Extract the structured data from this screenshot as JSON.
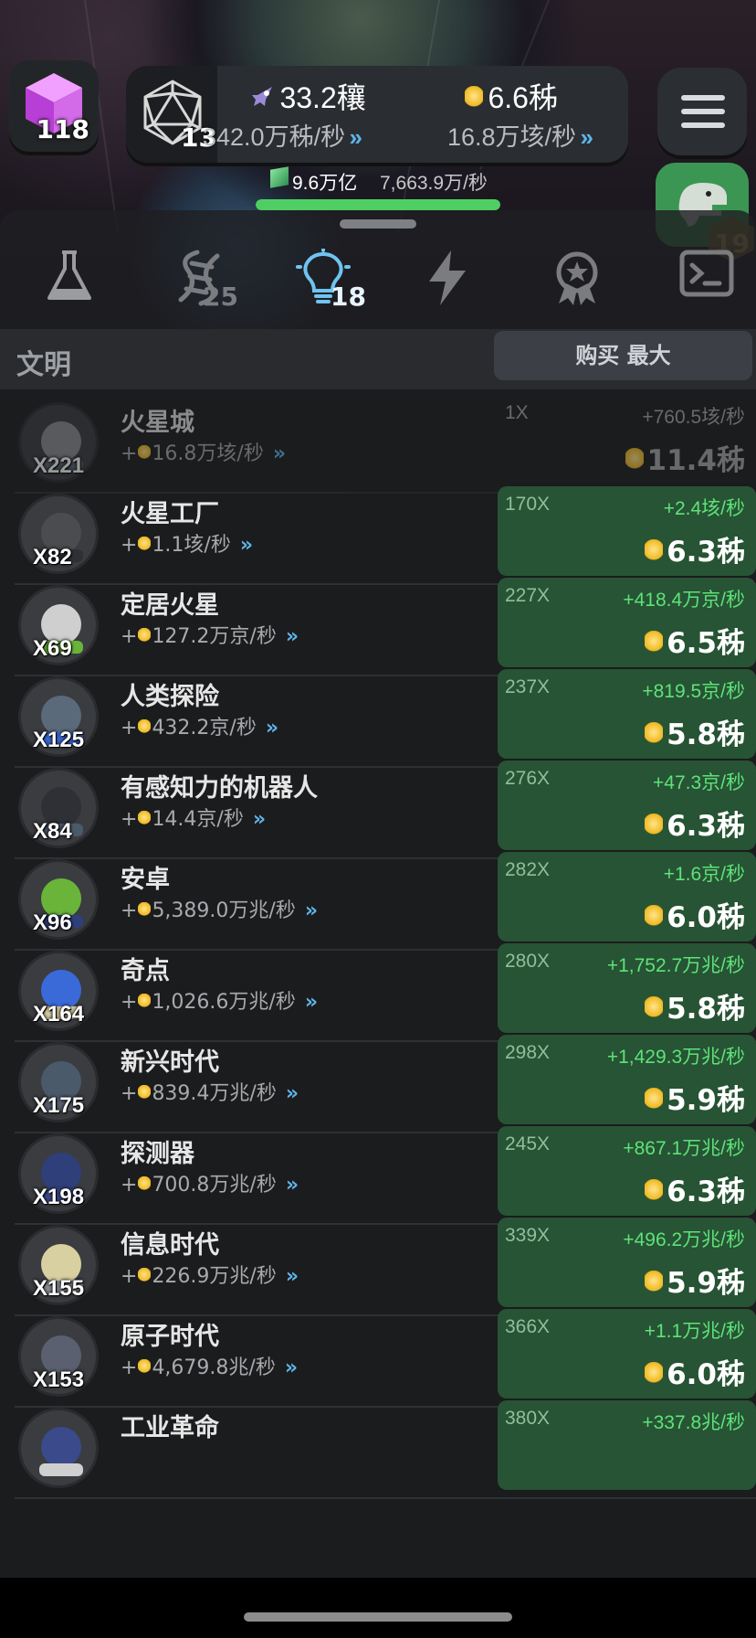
{
  "hud": {
    "cube_count": "118",
    "d20_count": "13",
    "primary": {
      "value": "33.2穰",
      "rate": "342.0万秭/秒"
    },
    "ideas": {
      "value": "6.6秭",
      "rate": "16.8万垓/秒"
    },
    "gems": {
      "value": "9.6万亿",
      "rate": "7,663.9万/秒"
    },
    "gem_progress_percent": 100,
    "dino_level": "19"
  },
  "tabs": [
    {
      "name": "science",
      "count": ""
    },
    {
      "name": "dna",
      "count": "25"
    },
    {
      "name": "ideas",
      "count": "18",
      "active": true
    },
    {
      "name": "power",
      "count": ""
    },
    {
      "name": "achievements",
      "count": ""
    },
    {
      "name": "terminal",
      "count": ""
    }
  ],
  "section": {
    "title": "文明",
    "buy_button": "购买 最大"
  },
  "rows": [
    {
      "name": "火星城",
      "qty": "X221",
      "rate": "16.8万垓/秒",
      "mult": "1X",
      "gain": "+760.5垓/秒",
      "cost": "11.4秭",
      "locked": true
    },
    {
      "name": "火星工厂",
      "qty": "X82",
      "rate": "1.1垓/秒",
      "mult": "170X",
      "gain": "+2.4垓/秒",
      "cost": "6.3秭"
    },
    {
      "name": "定居火星",
      "qty": "X69",
      "rate": "127.2万京/秒",
      "mult": "227X",
      "gain": "+418.4万京/秒",
      "cost": "6.5秭"
    },
    {
      "name": "人类探险",
      "qty": "X125",
      "rate": "432.2京/秒",
      "mult": "237X",
      "gain": "+819.5京/秒",
      "cost": "5.8秭"
    },
    {
      "name": "有感知力的机器人",
      "qty": "X84",
      "rate": "14.4京/秒",
      "mult": "276X",
      "gain": "+47.3京/秒",
      "cost": "6.3秭"
    },
    {
      "name": "安卓",
      "qty": "X96",
      "rate": "5,389.0万兆/秒",
      "mult": "282X",
      "gain": "+1.6京/秒",
      "cost": "6.0秭"
    },
    {
      "name": "奇点",
      "qty": "X164",
      "rate": "1,026.6万兆/秒",
      "mult": "280X",
      "gain": "+1,752.7万兆/秒",
      "cost": "5.8秭"
    },
    {
      "name": "新兴时代",
      "qty": "X175",
      "rate": "839.4万兆/秒",
      "mult": "298X",
      "gain": "+1,429.3万兆/秒",
      "cost": "5.9秭"
    },
    {
      "name": "探测器",
      "qty": "X198",
      "rate": "700.8万兆/秒",
      "mult": "245X",
      "gain": "+867.1万兆/秒",
      "cost": "6.3秭"
    },
    {
      "name": "信息时代",
      "qty": "X155",
      "rate": "226.9万兆/秒",
      "mult": "339X",
      "gain": "+496.2万兆/秒",
      "cost": "5.9秭"
    },
    {
      "name": "原子时代",
      "qty": "X153",
      "rate": "4,679.8兆/秒",
      "mult": "366X",
      "gain": "+1.1万兆/秒",
      "cost": "6.0秭"
    },
    {
      "name": "工业革命",
      "qty": "",
      "rate": "",
      "mult": "380X",
      "gain": "+337.8兆/秒",
      "cost": ""
    }
  ],
  "colors": {
    "accent_green": "#4fcf63",
    "buy_button_bg": "#275434",
    "chevron_blue": "#5fb4e8",
    "idea_yellow": "#f0b820",
    "cube_purple": "#d36ae8",
    "dino_green": "#3fa45a"
  }
}
